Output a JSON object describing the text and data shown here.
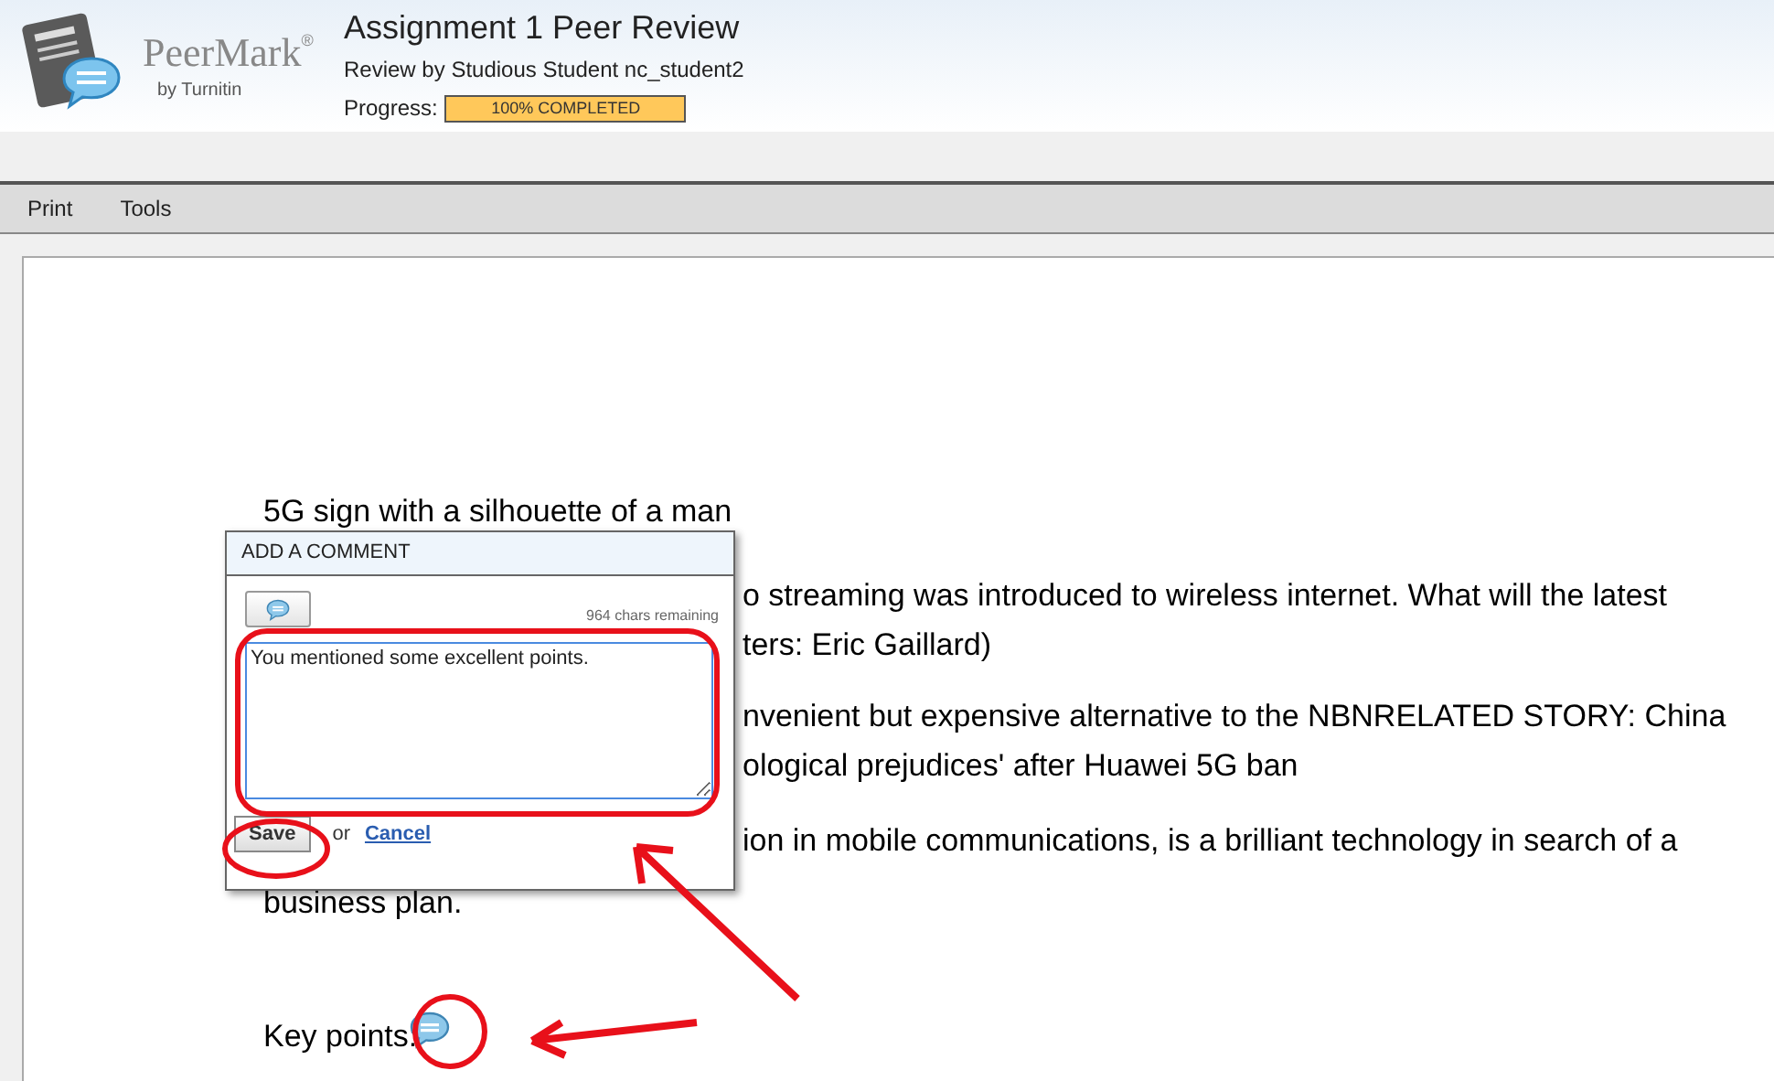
{
  "header": {
    "logo_name": "PeerMark",
    "logo_mark": "®",
    "logo_sub": "by Turnitin",
    "title": "Assignment 1 Peer Review",
    "subtitle": "Review by Studious Student nc_student2",
    "progress_label": "Progress:",
    "progress_text": "100% COMPLETED",
    "level": 1
  },
  "menu": [
    {
      "label": "Print"
    },
    {
      "label": "Tools"
    }
  ],
  "document": {
    "lines": [
      {
        "kind": "full",
        "text": "5G sign with a silhouette of a man"
      },
      {
        "kind": "beside",
        "text": "o streaming was introduced to wireless internet. What will the latest"
      },
      {
        "kind": "beside",
        "text": "ters: Eric Gaillard)"
      },
      {
        "kind": "beside",
        "text": "nvenient but expensive alternative to the NBNRELATED STORY: China"
      },
      {
        "kind": "beside",
        "text": "ological prejudices' after Huawei 5G ban"
      },
      {
        "kind": "beside",
        "text": "ion in mobile communications, is a brilliant technology in search of a"
      },
      {
        "kind": "full",
        "text": "business plan."
      }
    ],
    "key_points": "Key points:"
  },
  "comment_popup": {
    "title": "ADD A COMMENT",
    "chars_remaining": "964 chars remaining",
    "value": "You mentioned some excellent points.",
    "save": "Save",
    "or": "or",
    "cancel": "Cancel"
  }
}
